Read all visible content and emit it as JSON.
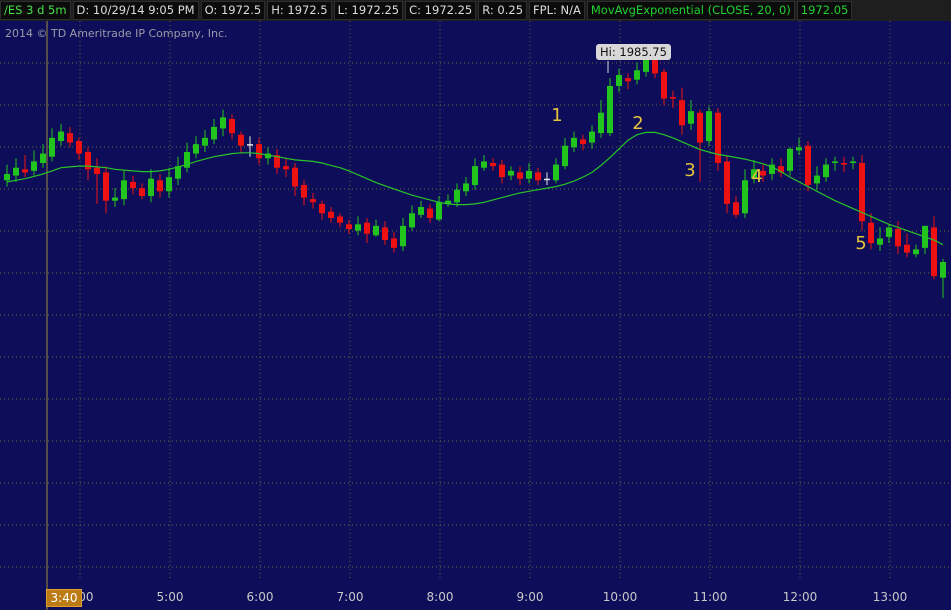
{
  "header": {
    "symbol": "/ES 3 d 5m",
    "date": "D: 10/29/14 9:05 PM",
    "open": "O: 1972.5",
    "high": "H: 1972.5",
    "low": "L: 1972.25",
    "close": "C: 1972.25",
    "range": "R: 0.25",
    "fpl": "FPL: N/A",
    "study": "MovAvgExponential (CLOSE, 20, 0)",
    "study_value": "1972.05"
  },
  "copyright": "2014 © TD Ameritrade IP Company, Inc.",
  "cursor_time": "3:40",
  "hi_label": "Hi: 1985.75",
  "colors": {
    "background": "#0d0d59",
    "up": "#22c41e",
    "down": "#ee1111",
    "flat": "#e6e6e6",
    "ma_line": "#28c428",
    "annotation": "#e5c33b",
    "grid": "#7f7f30"
  },
  "chart_data": {
    "type": "candlestick",
    "symbol": "/ES",
    "interval": "5m",
    "x_ticks": [
      "4:00",
      "5:00",
      "6:00",
      "7:00",
      "8:00",
      "9:00",
      "10:00",
      "11:00",
      "12:00",
      "13:00"
    ],
    "annotations": [
      {
        "text": "1",
        "time": "9:35"
      },
      {
        "text": "2",
        "time": "10:05"
      },
      {
        "text": "3",
        "time": "10:40"
      },
      {
        "text": "4",
        "time": "11:35"
      },
      {
        "text": "5",
        "time": "12:45"
      }
    ],
    "high_marker": {
      "label": "Hi: 1985.75",
      "value": 1985.75
    },
    "ylim": [
      1952,
      1987
    ],
    "series": [
      {
        "name": "MovAvgExponential (CLOSE, 20, 0)",
        "type": "line",
        "values": [
          1977.4,
          1977.5,
          1977.6,
          1977.75,
          1977.9,
          1978.1,
          1978.3,
          1978.35,
          1978.4,
          1978.4,
          1978.35,
          1978.3,
          1978.2,
          1978.15,
          1978.1,
          1978.05,
          1978.05,
          1978.1,
          1978.2,
          1978.35,
          1978.5,
          1978.7,
          1978.85,
          1979.0,
          1979.1,
          1979.2,
          1979.25,
          1979.25,
          1979.2,
          1979.1,
          1979.0,
          1978.9,
          1978.8,
          1978.75,
          1978.7,
          1978.6,
          1978.45,
          1978.3,
          1978.1,
          1977.85,
          1977.6,
          1977.35,
          1977.15,
          1976.95,
          1976.75,
          1976.55,
          1976.4,
          1976.25,
          1976.1,
          1976.0,
          1975.95,
          1975.95,
          1976.0,
          1976.1,
          1976.25,
          1976.4,
          1976.55,
          1976.7,
          1976.8,
          1976.9,
          1977.0,
          1977.1,
          1977.25,
          1977.45,
          1977.7,
          1978.0,
          1978.45,
          1978.95,
          1979.5,
          1980.05,
          1980.4,
          1980.55,
          1980.55,
          1980.4,
          1980.2,
          1979.95,
          1979.7,
          1979.45,
          1979.3,
          1979.15,
          1979.05,
          1978.95,
          1978.85,
          1978.7,
          1978.55,
          1978.35,
          1978.05,
          1977.7,
          1977.4,
          1977.1,
          1976.8,
          1976.5,
          1976.2,
          1975.95,
          1975.7,
          1975.45,
          1975.2,
          1974.95,
          1974.7,
          1974.5,
          1974.3,
          1974.1,
          1973.9,
          1973.7,
          1973.4
        ]
      },
      {
        "name": "Price",
        "type": "candlestick",
        "opens": [
          1977.5,
          1977.8,
          1978.2,
          1978.1,
          1978.6,
          1979.0,
          1980.0,
          1980.5,
          1980.0,
          1979.3,
          1978.3,
          1978.0,
          1976.2,
          1976.3,
          1977.4,
          1977.0,
          1976.5,
          1977.5,
          1976.8,
          1977.6,
          1978.3,
          1979.2,
          1979.7,
          1980.1,
          1980.8,
          1981.4,
          1980.4,
          1979.8,
          1979.8,
          1978.9,
          1979.1,
          1978.4,
          1978.3,
          1977.2,
          1976.3,
          1976.0,
          1975.5,
          1975.2,
          1974.7,
          1974.3,
          1974.8,
          1974.0,
          1974.5,
          1973.8,
          1973.3,
          1974.5,
          1975.3,
          1975.7,
          1975.0,
          1976.0,
          1976.1,
          1976.8,
          1977.2,
          1978.3,
          1978.6,
          1978.5,
          1977.8,
          1978.0,
          1977.6,
          1978.0,
          1977.6,
          1977.5,
          1978.4,
          1979.6,
          1980.1,
          1979.9,
          1980.5,
          1980.5,
          1983.5,
          1984.0,
          1983.9,
          1984.4,
          1985.5,
          1984.4,
          1982.8,
          1982.6,
          1981.1,
          1981.8,
          1980.0,
          1981.8,
          1978.7,
          1976.1,
          1975.4,
          1977.6,
          1978.1,
          1977.9,
          1978.4,
          1978.1,
          1979.4,
          1979.7,
          1977.3,
          1977.7,
          1978.6,
          1978.6,
          1978.6,
          1978.6,
          1974.8,
          1973.4,
          1973.9,
          1974.4,
          1973.4,
          1972.8,
          1973.2,
          1974.5,
          1971.3
        ]
      },
      {
        "name": "Price_close",
        "type": "candlestick",
        "closes": [
          1977.9,
          1978.3,
          1978.0,
          1978.7,
          1979.2,
          1980.2,
          1980.6,
          1979.9,
          1979.2,
          1978.2,
          1977.9,
          1976.2,
          1976.4,
          1977.5,
          1977.0,
          1976.5,
          1977.6,
          1976.8,
          1977.7,
          1978.4,
          1979.3,
          1979.8,
          1980.2,
          1980.9,
          1981.5,
          1980.5,
          1979.7,
          1979.8,
          1978.9,
          1979.2,
          1978.3,
          1978.2,
          1977.1,
          1976.4,
          1976.1,
          1975.4,
          1975.1,
          1974.8,
          1974.4,
          1974.7,
          1974.1,
          1974.6,
          1973.7,
          1973.2,
          1974.6,
          1975.4,
          1975.8,
          1975.1,
          1976.1,
          1976.2,
          1976.9,
          1977.3,
          1978.4,
          1978.7,
          1978.4,
          1977.7,
          1978.1,
          1977.6,
          1978.1,
          1977.5,
          1977.6,
          1978.5,
          1979.7,
          1980.2,
          1979.8,
          1980.6,
          1981.8,
          1983.5,
          1984.2,
          1983.8,
          1984.5,
          1985.6,
          1984.3,
          1982.7,
          1982.7,
          1981.0,
          1981.9,
          1979.9,
          1981.9,
          1978.6,
          1976.0,
          1975.3,
          1977.5,
          1978.2,
          1977.8,
          1978.5,
          1978.0,
          1979.5,
          1979.6,
          1977.2,
          1977.8,
          1978.5,
          1978.7,
          1978.5,
          1978.7,
          1974.9,
          1973.5,
          1973.8,
          1974.5,
          1973.3,
          1972.9,
          1973.1,
          1974.6,
          1971.4,
          1972.3
        ]
      },
      {
        "name": "Price_high",
        "type": "candlestick",
        "highs": [
          1978.5,
          1978.9,
          1979.1,
          1979.4,
          1979.8,
          1980.8,
          1981.1,
          1980.9,
          1980.2,
          1979.6,
          1978.9,
          1978.4,
          1977.0,
          1978.1,
          1977.8,
          1977.3,
          1978.2,
          1977.9,
          1978.3,
          1979.0,
          1979.9,
          1980.3,
          1980.7,
          1981.4,
          1982.0,
          1981.7,
          1980.6,
          1980.3,
          1980.2,
          1979.6,
          1979.5,
          1978.9,
          1978.6,
          1977.5,
          1976.7,
          1976.2,
          1975.8,
          1975.4,
          1975.0,
          1975.2,
          1975.1,
          1975.0,
          1974.9,
          1974.2,
          1975.1,
          1975.9,
          1976.2,
          1976.0,
          1976.5,
          1976.6,
          1977.3,
          1977.7,
          1978.9,
          1979.1,
          1978.9,
          1978.8,
          1978.4,
          1978.4,
          1978.6,
          1978.3,
          1978.0,
          1978.9,
          1980.2,
          1980.6,
          1980.4,
          1981.0,
          1982.6,
          1984.0,
          1984.6,
          1984.3,
          1985.0,
          1985.75,
          1985.7,
          1984.6,
          1983.2,
          1983.4,
          1982.6,
          1982.0,
          1982.2,
          1982.1,
          1979.1,
          1976.5,
          1978.2,
          1978.8,
          1978.5,
          1978.9,
          1978.9,
          1979.6,
          1980.2,
          1980.0,
          1978.4,
          1978.9,
          1979.0,
          1979.0,
          1979.0,
          1979.1,
          1975.4,
          1974.5,
          1974.7,
          1974.9,
          1974.1,
          1973.4,
          1973.8,
          1975.2,
          1972.5
        ]
      },
      {
        "name": "Price_low",
        "type": "candlestick",
        "lows": [
          1977.1,
          1977.4,
          1977.7,
          1977.8,
          1978.3,
          1978.7,
          1979.7,
          1979.6,
          1978.8,
          1977.5,
          1976.0,
          1975.4,
          1975.8,
          1975.9,
          1976.6,
          1976.3,
          1976.1,
          1976.4,
          1976.4,
          1977.2,
          1978.0,
          1978.9,
          1979.3,
          1979.8,
          1980.3,
          1980.1,
          1979.2,
          1979.0,
          1978.5,
          1978.5,
          1977.9,
          1977.7,
          1976.5,
          1975.9,
          1975.7,
          1975.0,
          1974.8,
          1974.5,
          1974.1,
          1974.0,
          1973.5,
          1973.9,
          1973.4,
          1972.9,
          1973.0,
          1974.3,
          1975.1,
          1974.8,
          1974.9,
          1975.8,
          1975.8,
          1976.5,
          1976.9,
          1978.1,
          1978.1,
          1977.3,
          1977.5,
          1977.2,
          1977.3,
          1977.2,
          1977.2,
          1977.3,
          1978.2,
          1979.3,
          1979.4,
          1979.5,
          1980.2,
          1980.3,
          1983.1,
          1983.3,
          1983.6,
          1984.1,
          1984.0,
          1982.3,
          1982.1,
          1980.4,
          1980.7,
          1977.4,
          1979.7,
          1978.1,
          1975.4,
          1975.1,
          1975.1,
          1977.3,
          1977.4,
          1977.5,
          1977.7,
          1977.8,
          1979.1,
          1976.8,
          1976.9,
          1977.4,
          1978.1,
          1978.0,
          1978.2,
          1974.3,
          1973.1,
          1973.0,
          1973.5,
          1972.8,
          1972.6,
          1972.6,
          1972.8,
          1971.2,
          1970.0
        ]
      }
    ]
  }
}
